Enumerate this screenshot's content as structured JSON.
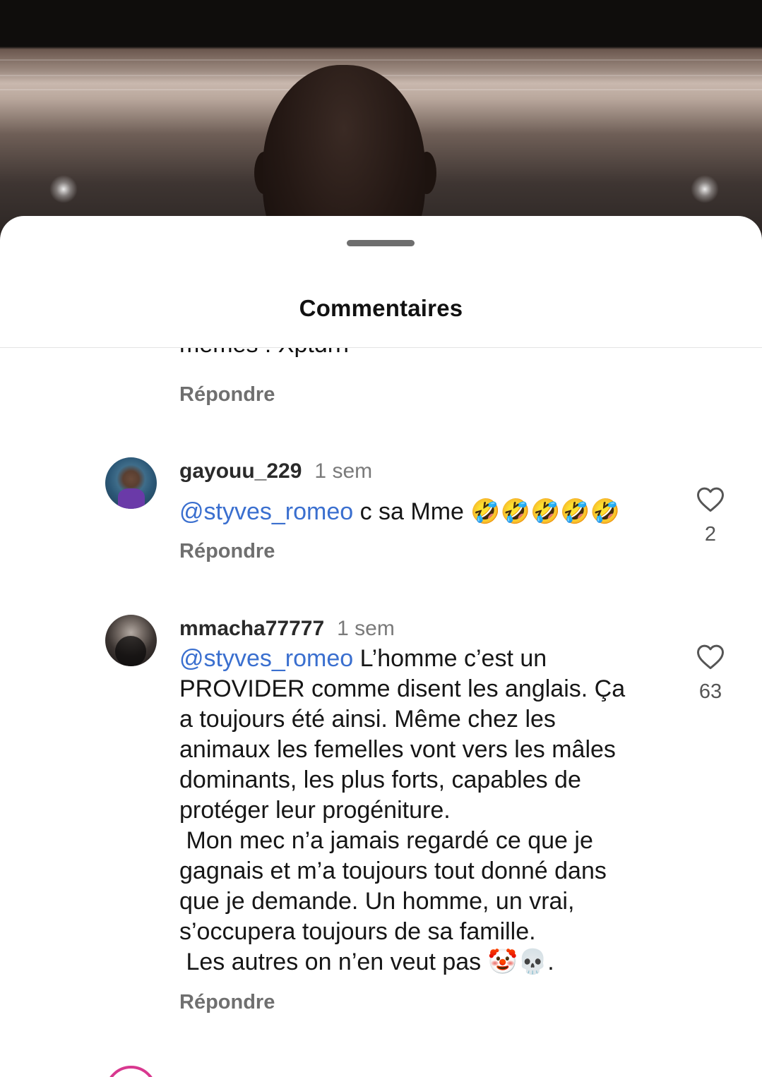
{
  "sheet": {
    "title": "Commentaires"
  },
  "partial_comment": {
    "text_tail": "memes ! Xptdrrr",
    "reply_label": "Répondre"
  },
  "comments": [
    {
      "username": "gayouu_229",
      "time": "1 sem",
      "mention": "@styves_romeo",
      "text": " c sa Mme 🤣🤣🤣🤣🤣",
      "likes": "2",
      "reply_label": "Répondre",
      "avatar": "user-avatar-photo"
    },
    {
      "username": "mmacha77777",
      "time": "1 sem",
      "mention": "@styves_romeo",
      "text": " L’homme c’est un\nPROVIDER comme disent les anglais. Ça\na toujours été ainsi. Même chez les\nanimaux les femelles vont vers les mâles\ndominants, les plus forts, capables de\nprotéger leur progéniture.\n Mon mec n’a jamais regardé ce que je\ngagnais et m’a toujours tout donné dans\nque je demande. Un homme, un vrai,\ns’occupera toujours de sa famille.\n Les autres on n’en veut pas 🤡💀.",
      "likes": "63",
      "reply_label": "Répondre",
      "avatar": "user-avatar-photo"
    }
  ],
  "colors": {
    "mention": "#3a6fcf",
    "username": "#2a2a2a",
    "muted": "#7a7a7a",
    "reply": "#6f6f6f",
    "next_avatar_ring": "#d8388f"
  },
  "icons": {
    "like": "heart-outline-icon",
    "handle": "drag-handle"
  }
}
